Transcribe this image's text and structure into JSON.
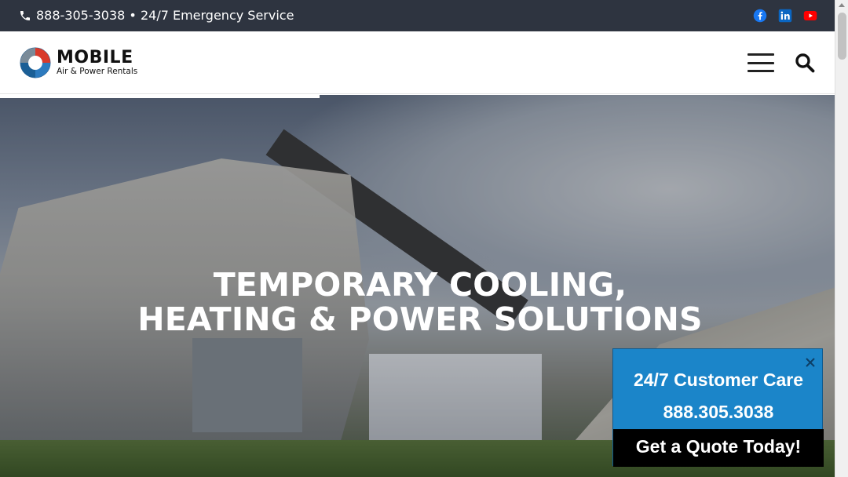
{
  "topbar": {
    "phone": "888-305-3038 • 24/7 Emergency Service",
    "social": [
      {
        "icon": "facebook-icon",
        "color": "#1877f2"
      },
      {
        "icon": "linkedin-icon",
        "color": "#0a66c2"
      },
      {
        "icon": "youtube-icon",
        "color": "#ff0000"
      }
    ]
  },
  "header": {
    "logo_name": "MOBILE",
    "logo_tagline": "Air & Power Rentals"
  },
  "hero": {
    "headline_line1": "TEMPORARY COOLING,",
    "headline_line2": "HEATING & POWER SOLUTIONS"
  },
  "care_box": {
    "title": "24/7 Customer Care",
    "phone": "888.305.3038",
    "cta": "Get a Quote Today!",
    "accent": "#1b85c9"
  }
}
